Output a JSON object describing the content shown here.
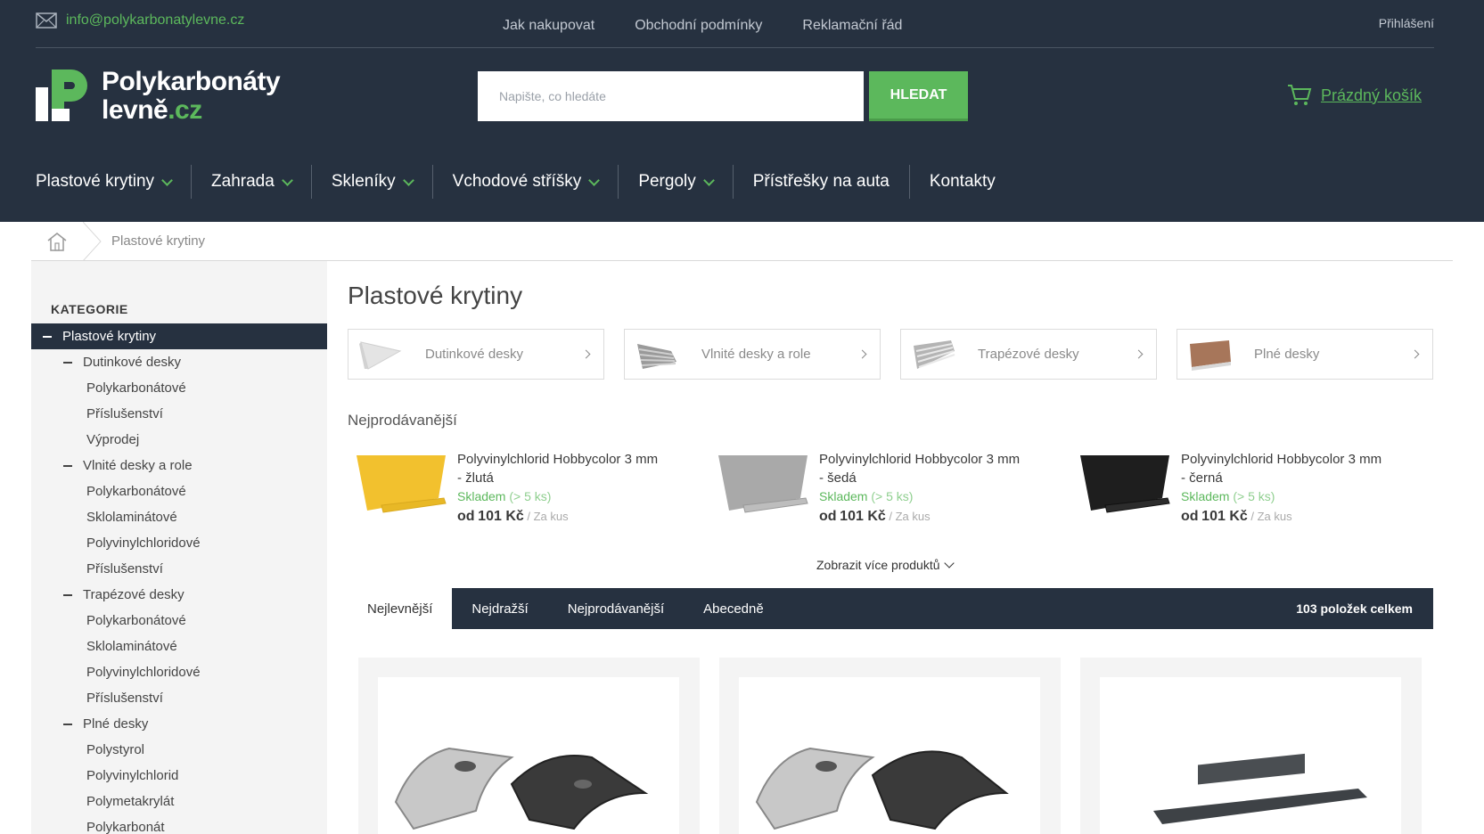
{
  "header": {
    "email": "info@polykarbonatylevne.cz",
    "top_links": [
      "Jak nakupovat",
      "Obchodní podmínky",
      "Reklamační řád"
    ],
    "login": "Přihlášení",
    "logo_line1": "Polykarbonáty",
    "logo_line2_main": "levně",
    "logo_line2_accent": ".cz",
    "search_placeholder": "Napište, co hledáte",
    "search_button": "HLEDAT",
    "cart_label": "Prázdný košík",
    "nav": [
      "Plastové krytiny",
      "Zahrada",
      "Skleníky",
      "Vchodové stříšky",
      "Pergoly",
      "Přístřešky na auta",
      "Kontakty"
    ]
  },
  "breadcrumb": {
    "current": "Plastové krytiny"
  },
  "sidebar": {
    "title": "KATEGORIE",
    "items": [
      {
        "label": "Plastové krytiny"
      },
      {
        "label": "Dutinkové desky"
      },
      {
        "label": "Polykarbonátové"
      },
      {
        "label": "Příslušenství"
      },
      {
        "label": "Výprodej"
      },
      {
        "label": "Vlnité desky a role"
      },
      {
        "label": "Polykarbonátové"
      },
      {
        "label": "Sklolaminátové"
      },
      {
        "label": "Polyvinylchloridové"
      },
      {
        "label": "Příslušenství"
      },
      {
        "label": "Trapézové desky"
      },
      {
        "label": "Polykarbonátové"
      },
      {
        "label": "Sklolaminátové"
      },
      {
        "label": "Polyvinylchloridové"
      },
      {
        "label": "Příslušenství"
      },
      {
        "label": "Plné desky"
      },
      {
        "label": "Polystyrol"
      },
      {
        "label": "Polyvinylchlorid"
      },
      {
        "label": "Polymetakrylát"
      },
      {
        "label": "Polykarbonát"
      }
    ]
  },
  "main": {
    "title": "Plastové krytiny",
    "subcategories": [
      "Dutinkové desky",
      "Vlnité desky a role",
      "Trapézové desky",
      "Plné desky"
    ],
    "bestsellers_title": "Nejprodávanější",
    "bestsellers": [
      {
        "name1": "Polyvinylchlorid Hobbycolor 3 mm",
        "name2": "- žlutá",
        "stock": "Skladem",
        "stock_qty": "(> 5 ks)",
        "price_prefix": "od",
        "price": "101 Kč",
        "unit": "/ Za kus",
        "color": "#f2c12e"
      },
      {
        "name1": "Polyvinylchlorid Hobbycolor 3 mm",
        "name2": "- šedá",
        "stock": "Skladem",
        "stock_qty": "(> 5 ks)",
        "price_prefix": "od",
        "price": "101 Kč",
        "unit": "/ Za kus",
        "color": "#a9a9a9"
      },
      {
        "name1": "Polyvinylchlorid Hobbycolor 3 mm",
        "name2": "- černá",
        "stock": "Skladem",
        "stock_qty": "(> 5 ks)",
        "price_prefix": "od",
        "price": "101 Kč",
        "unit": "/ Za kus",
        "color": "#1e1e1e"
      }
    ],
    "show_more": "Zobrazit více produktů",
    "sort_tabs": [
      "Nejlevnější",
      "Nejdražší",
      "Nejprodávanější",
      "Abecedně"
    ],
    "count": "103 položek celkem"
  },
  "colors": {
    "header_bg": "#263140",
    "accent": "#5cb85c",
    "sidebar_bg": "#f4f4f4"
  }
}
